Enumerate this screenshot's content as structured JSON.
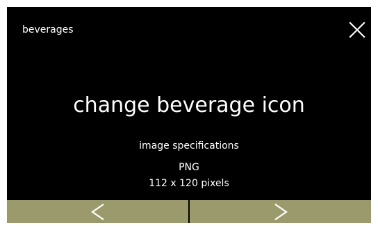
{
  "header": {
    "title": "beverages",
    "close_icon": "close-icon"
  },
  "main": {
    "title": "change beverage icon",
    "subtitle": "image specifications",
    "format": "PNG",
    "size": "112 x 120 pixels"
  },
  "nav": {
    "prev_icon": "chevron-left-icon",
    "next_icon": "chevron-right-icon"
  },
  "colors": {
    "background": "#000000",
    "text": "#ffffff",
    "nav_button": "#9b9a6c"
  }
}
